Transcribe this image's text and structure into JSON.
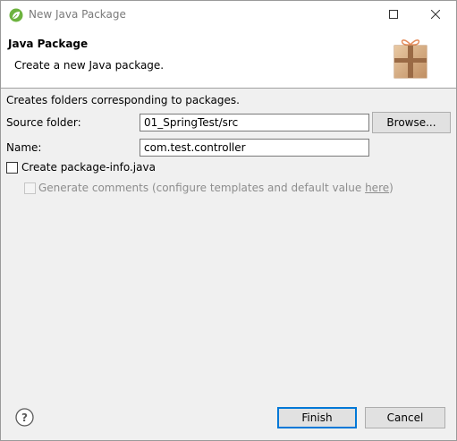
{
  "window": {
    "title": "New Java Package",
    "icons": {
      "app": "spring-leaf-icon",
      "maximize": "maximize-icon",
      "close": "close-icon"
    }
  },
  "header": {
    "title": "Java Package",
    "message": "Create a new Java package.",
    "image": "package-gift-box-icon"
  },
  "form": {
    "description": "Creates folders corresponding to packages.",
    "source_folder": {
      "label": "Source folder:",
      "value": "01_SpringTest/src",
      "browse_label": "Browse..."
    },
    "name": {
      "label": "Name:",
      "value": "com.test.controller"
    },
    "create_package_info": {
      "label": "Create package-info.java",
      "checked": false
    },
    "generate_comments": {
      "label": "Generate comments (configure templates and default value ",
      "link": "here",
      "suffix": ")",
      "checked": false,
      "enabled": false
    }
  },
  "footer": {
    "help_icon": "help-icon",
    "finish_label": "Finish",
    "cancel_label": "Cancel"
  },
  "colors": {
    "dialog_bg": "#f0f0f0",
    "default_button_border": "#0078d7",
    "disabled_text": "#8d8d8d"
  }
}
